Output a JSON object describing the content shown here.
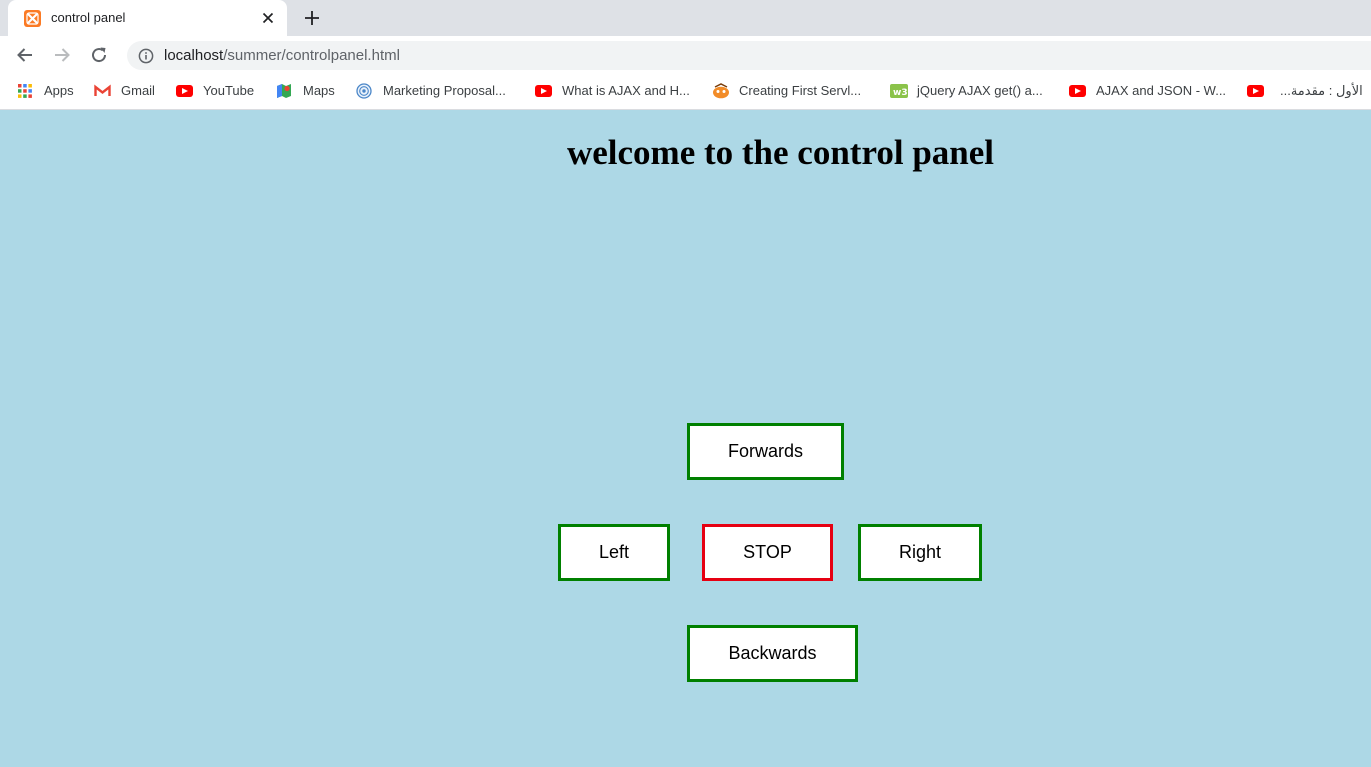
{
  "browser": {
    "tab_title": "control panel",
    "url_host": "localhost",
    "url_path": "/summer/controlpanel.html",
    "bookmarks": [
      {
        "label": "Apps",
        "icon": "apps-grid-icon"
      },
      {
        "label": "Gmail",
        "icon": "gmail-icon"
      },
      {
        "label": "YouTube",
        "icon": "youtube-icon"
      },
      {
        "label": "Maps",
        "icon": "maps-icon"
      },
      {
        "label": "Marketing Proposal...",
        "icon": "globe-icon"
      },
      {
        "label": "What is AJAX and H...",
        "icon": "youtube-icon"
      },
      {
        "label": "Creating First Servl...",
        "icon": "site-icon"
      },
      {
        "label": "jQuery AJAX get() a...",
        "icon": "w3schools-icon"
      },
      {
        "label": "AJAX and JSON - W...",
        "icon": "youtube-icon"
      },
      {
        "label": "الأول : مقدمة...",
        "icon": "youtube-icon"
      }
    ]
  },
  "page": {
    "title": "welcome to the control panel",
    "background": "#add8e6",
    "buttons": {
      "forwards": "Forwards",
      "left": "Left",
      "stop": "STOP",
      "right": "Right",
      "backwards": "Backwards"
    },
    "colors": {
      "move_border": "#008000",
      "stop_border": "#e60012"
    }
  }
}
